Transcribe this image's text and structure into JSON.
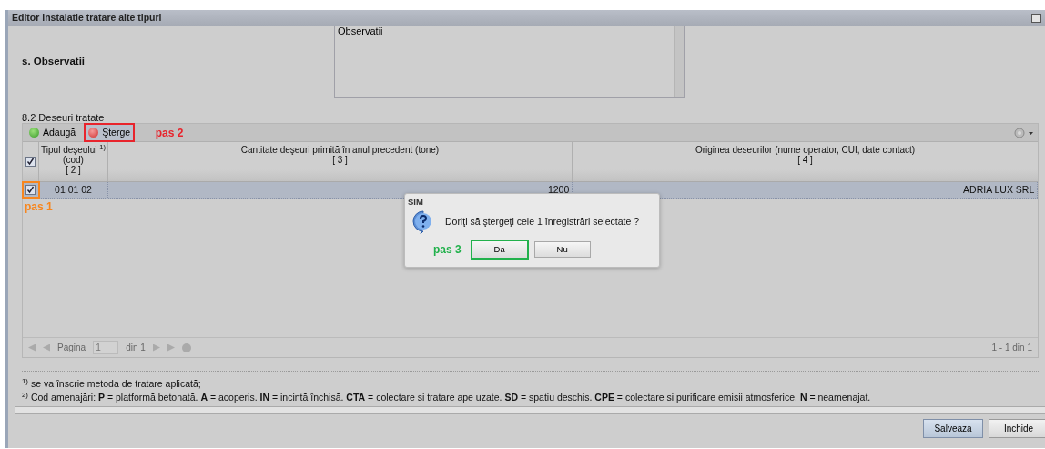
{
  "window": {
    "title": "Editor instalatie tratare alte tipuri"
  },
  "observations": {
    "label": "s. Observatii",
    "value": "Observatii"
  },
  "section_title": "8.2 Deseuri tratate",
  "toolbar": [
    {
      "label": "Adaugă",
      "kind": "add"
    },
    {
      "label": "Şterge",
      "kind": "delete",
      "annotation": {
        "text": "pas 2",
        "color": "#e8242c"
      }
    }
  ],
  "grid": {
    "header_checked": true,
    "columns": [
      {
        "lines": [
          "Tipul deşeului $^{1)}$",
          "(cod)",
          "[ 2 ]"
        ]
      },
      {
        "lines": [
          "Cantitate deşeuri primită în anul precedent (tone)",
          "[ 3 ]"
        ]
      },
      {
        "lines": [
          "Originea deseurilor (nume operator, CUI, date contact)",
          "[ 4 ]"
        ]
      }
    ],
    "rows": [
      {
        "checked": true,
        "selected": true,
        "cells": [
          "01 01 02",
          "1200",
          "ADRIA LUX SRL"
        ],
        "annotation": {
          "text": "pas 1",
          "color": "#f7861e"
        }
      }
    ],
    "paging": {
      "page_label": "Pagina",
      "page": "1",
      "of": "din 1",
      "summary": "1 - 1 din 1",
      "disabled": true
    }
  },
  "footnotes": [
    "$^{1)}$ se va înscrie metoda de tratare aplicată;",
    "$^{2)}$ Cod amenajări: **P** = platformă betonată. **A** = acoperis. **IN** = incintă închisă. **CTA** = colectare si tratare ape uzate. **SD** = spatiu deschis. **CPE** = colectare si purificare emisii atmosferice. **N** = neamenajat."
  ],
  "buttons": [
    {
      "label": "Salveaza",
      "focused": true
    },
    {
      "label": "Inchide",
      "focused": false
    }
  ],
  "dialog": {
    "title": "SIM",
    "message": "Doriţi să ştergeţi cele 1 înregistrări selectate ?",
    "buttons": [
      {
        "label": "Da",
        "annotation": {
          "text": "pas 3",
          "color": "#22b14c"
        }
      },
      {
        "label": "Nu"
      }
    ]
  }
}
